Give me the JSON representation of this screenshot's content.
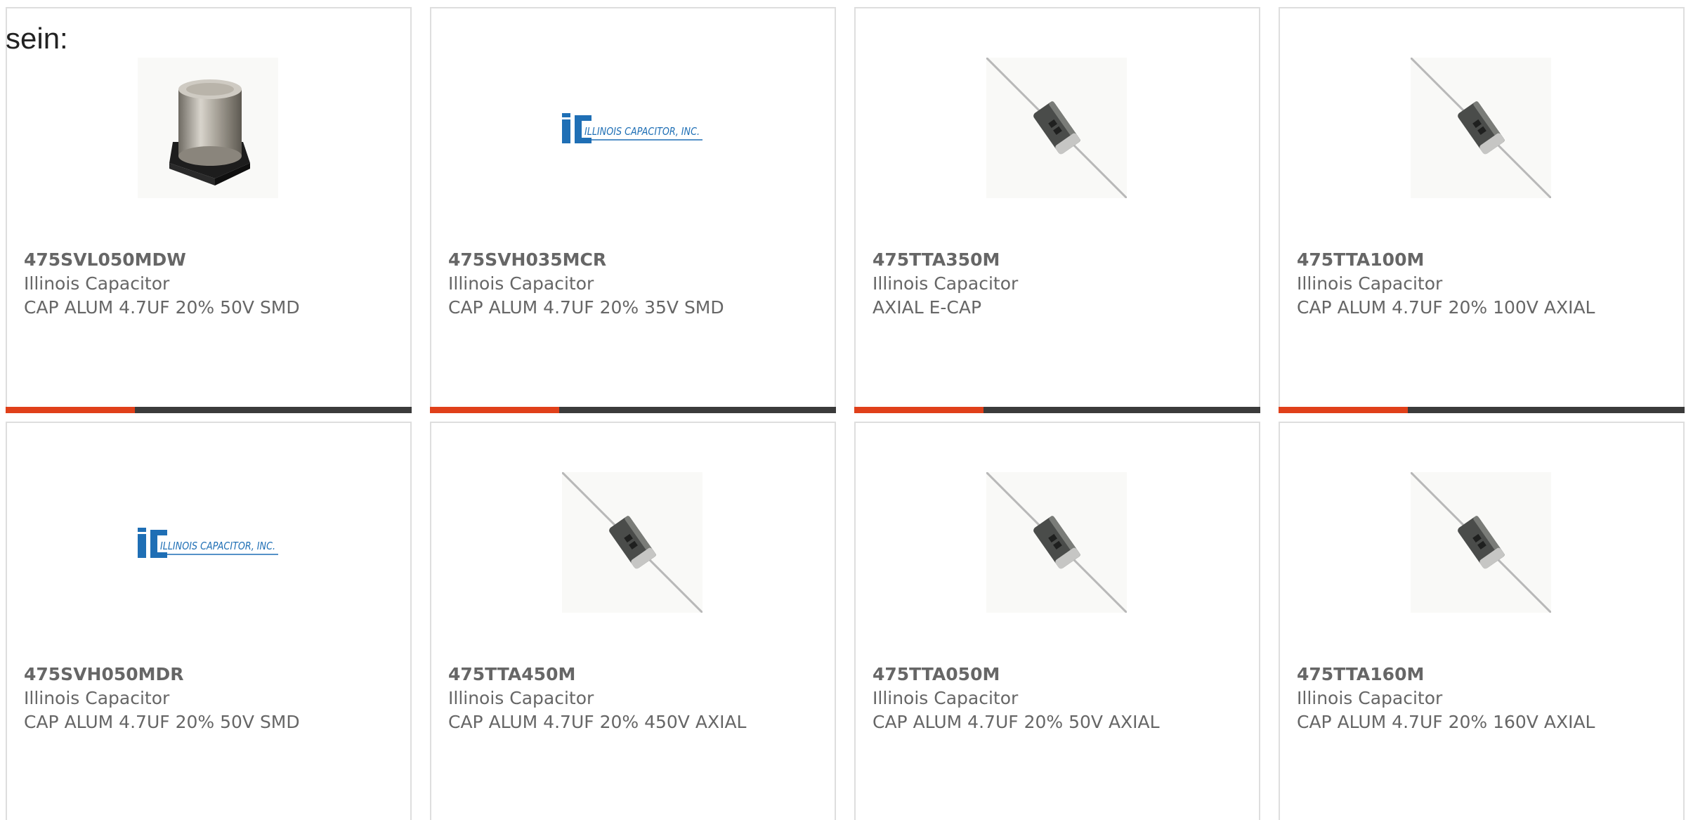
{
  "lead_text": "sein:",
  "accent_color": "#e0401a",
  "bar_color": "#3b3b3b",
  "products": [
    {
      "part": "475SVL050MDW",
      "manufacturer": "Illinois Capacitor",
      "description": "CAP ALUM 4.7UF 20% 50V SMD",
      "image": "smd-capacitor-icon"
    },
    {
      "part": "475SVH035MCR",
      "manufacturer": "Illinois Capacitor",
      "description": "CAP ALUM 4.7UF 20% 35V SMD",
      "image": "illinois-capacitor-logo",
      "logo_text": "ILLINOIS CAPACITOR, INC."
    },
    {
      "part": "475TTA350M",
      "manufacturer": "Illinois Capacitor",
      "description": "AXIAL E-CAP",
      "image": "axial-capacitor-icon"
    },
    {
      "part": "475TTA100M",
      "manufacturer": "Illinois Capacitor",
      "description": "CAP ALUM 4.7UF 20% 100V AXIAL",
      "image": "axial-capacitor-icon"
    },
    {
      "part": "475SVH050MDR",
      "manufacturer": "Illinois Capacitor",
      "description": "CAP ALUM 4.7UF 20% 50V SMD",
      "image": "illinois-capacitor-logo",
      "logo_text": "ILLINOIS CAPACITOR, INC."
    },
    {
      "part": "475TTA450M",
      "manufacturer": "Illinois Capacitor",
      "description": "CAP ALUM 4.7UF 20% 450V AXIAL",
      "image": "axial-capacitor-icon"
    },
    {
      "part": "475TTA050M",
      "manufacturer": "Illinois Capacitor",
      "description": "CAP ALUM 4.7UF 20% 50V AXIAL",
      "image": "axial-capacitor-icon"
    },
    {
      "part": "475TTA160M",
      "manufacturer": "Illinois Capacitor",
      "description": "CAP ALUM 4.7UF 20% 160V AXIAL",
      "image": "axial-capacitor-icon"
    }
  ]
}
